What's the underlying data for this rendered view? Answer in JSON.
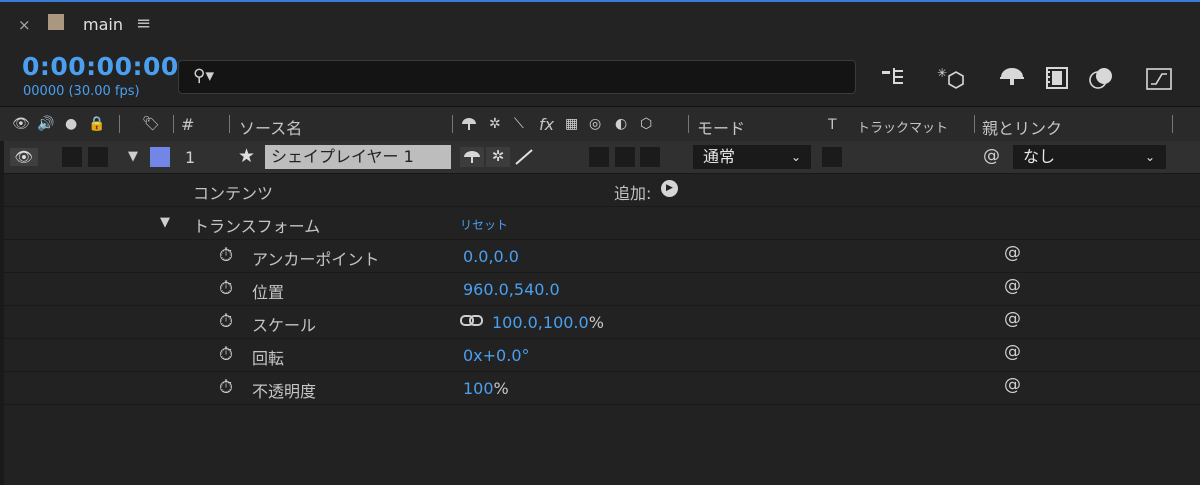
{
  "tab": {
    "close_icon": "×",
    "title": "main",
    "menu_icon": "≡",
    "swatch_color": "#a99780"
  },
  "toolbar": {
    "timecode": "0:00:00:00",
    "frames": "00000 (30.00 fps)",
    "search_placeholder": "",
    "icons": [
      "draft-3d-icon",
      "shy-layers-icon",
      "frame-blending-icon",
      "motion-blur-icon",
      "graph-editor-icon"
    ]
  },
  "header": {
    "hash": "#",
    "source_name": "ソース名",
    "mode": "モード",
    "t": "T",
    "track_matte": "トラックマット",
    "parent_link": "親とリンク"
  },
  "layer": {
    "number": "1",
    "name": "シェイプレイヤー 1",
    "label_color": "#7386e8",
    "mode": "通常",
    "parent": "なし"
  },
  "props": {
    "contents": "コンテンツ",
    "add_label": "追加:",
    "transform": "トランスフォーム",
    "reset": "リセット",
    "anchor_label": "アンカーポイント",
    "anchor_value": "0.0,0.0",
    "position_label": "位置",
    "position_value": "960.0,540.0",
    "scale_label": "スケール",
    "scale_value": "100.0,100.0",
    "scale_unit": "%",
    "rotation_label": "回転",
    "rotation_value": "0x+0.0°",
    "opacity_label": "不透明度",
    "opacity_value": "100",
    "opacity_unit": "%"
  }
}
